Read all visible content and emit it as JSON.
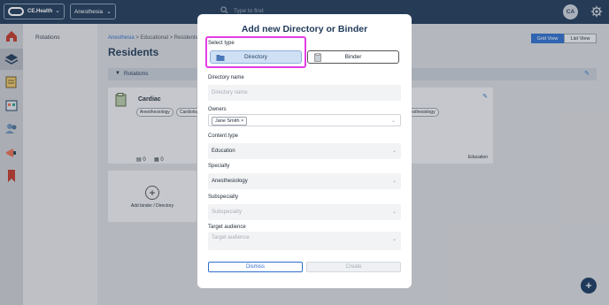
{
  "header": {
    "logo_text": "CE.Health",
    "specialty_selected": "Anesthesia",
    "search_placeholder": "Type to find",
    "avatar_initials": "CA"
  },
  "subnav": {
    "items": [
      "Rotations"
    ]
  },
  "main": {
    "breadcrumb": {
      "first": "Anesthesia",
      "second": "Educational",
      "third": "Residents",
      "sep": ">"
    },
    "page_title": "Residents",
    "view_toggle": {
      "grid": "Grid View",
      "list": "List View"
    },
    "section_label": "Rotations",
    "cards": [
      {
        "title": "Cardiac",
        "tags": [
          "Anesthesiology",
          "Cardiology"
        ],
        "binders": "0",
        "files": "0"
      },
      {
        "title": "o",
        "tags": [
          "nesthesiology"
        ],
        "footer": "Education"
      }
    ],
    "add_card_label": "Add binder / Directory"
  },
  "modal": {
    "title": "Add new Directory or Binder",
    "select_type_label": "Select type",
    "type_directory": "Directory",
    "type_binder": "Binder",
    "directory_name_label": "Directory name",
    "directory_name_placeholder": "Directory name",
    "owners_label": "Owners",
    "owner_chip": "Jane Smith",
    "content_type_label": "Content type",
    "content_type_value": "Education",
    "specialty_label": "Specialty",
    "specialty_value": "Anesthesiology",
    "subspecialty_label": "Subspecialty",
    "subspecialty_placeholder": "Subspecialty",
    "target_audience_label": "Target audience",
    "target_audience_placeholder": "Target audience",
    "dismiss_label": "Dismiss",
    "create_label": "Create"
  },
  "colors": {
    "accent": "#2f6fce",
    "navy": "#1f3a5a",
    "highlight": "#e43ce8"
  }
}
